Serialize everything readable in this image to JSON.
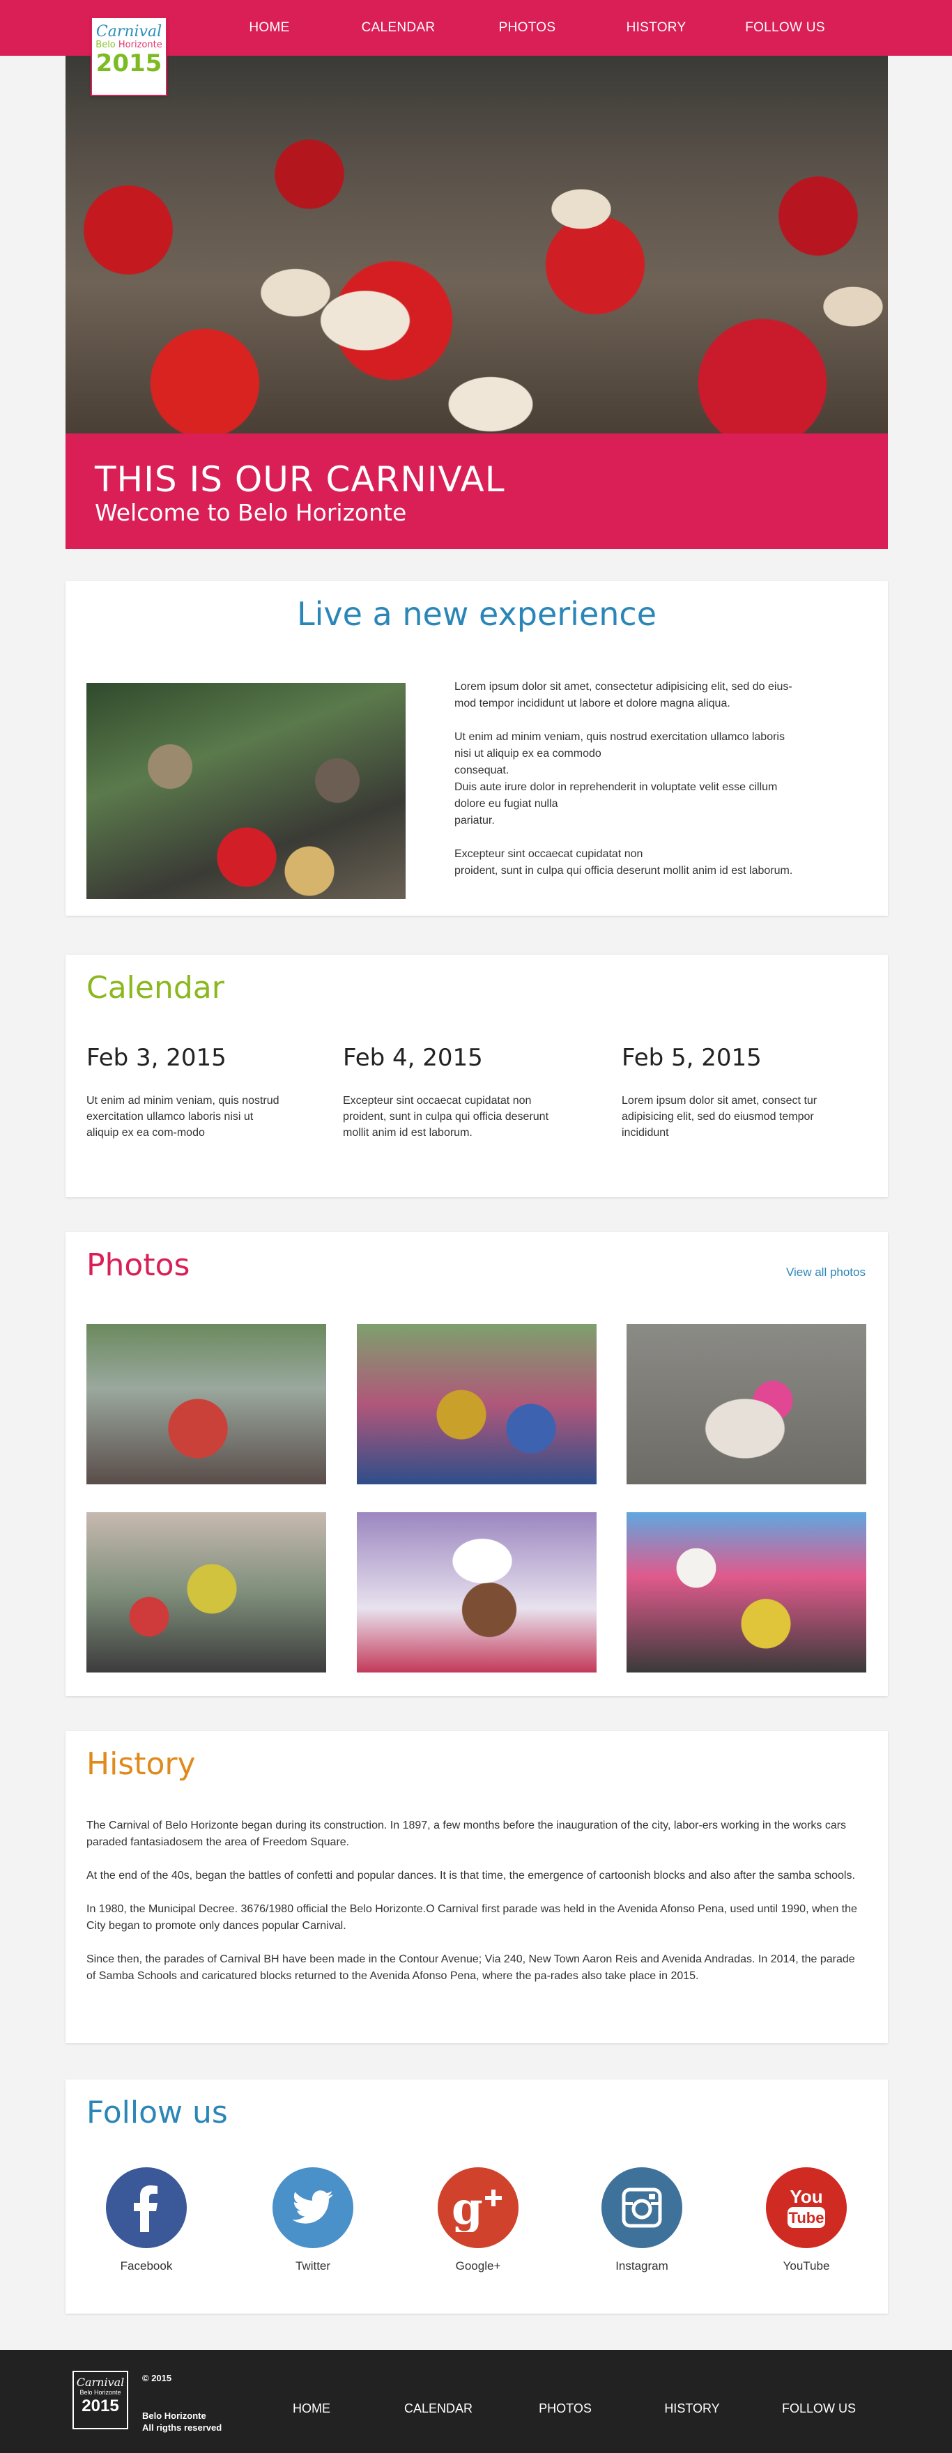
{
  "logo": {
    "line1": "Carnival",
    "line2a": "Belo",
    "line2b": "Horizonte",
    "line3": "2015"
  },
  "nav": {
    "items": [
      {
        "label": "HOME"
      },
      {
        "label": "CALENDAR"
      },
      {
        "label": "PHOTOS"
      },
      {
        "label": "HISTORY"
      },
      {
        "label": "FOLLOW US"
      }
    ]
  },
  "hero": {
    "title": "THIS IS OUR CARNIVAL",
    "subtitle": "Welcome to Belo Horizonte"
  },
  "experience": {
    "title": "Live a new experience",
    "paragraphs": [
      "Lorem ipsum dolor sit amet, consectetur adipisicing elit, sed do eius-\nmod tempor incididunt ut labore et dolore magna aliqua.",
      "Ut enim ad minim veniam, quis nostrud exercitation ullamco laboris\nnisi ut aliquip ex ea commodo\nconsequat.\nDuis aute irure dolor in reprehenderit in voluptate velit esse cillum\ndolore eu fugiat nulla\npariatur.",
      "Excepteur sint occaecat cupidatat non\nproident, sunt in culpa qui officia deserunt mollit anim id est laborum."
    ]
  },
  "calendar": {
    "title": "Calendar",
    "days": [
      {
        "date": "Feb 3, 2015",
        "desc": "Ut enim ad minim veniam, quis nostrud exercitation ullamco laboris nisi ut aliquip ex ea com-modo"
      },
      {
        "date": "Feb 4, 2015",
        "desc": "Excepteur sint occaecat cupidatat non proident, sunt in culpa qui officia deserunt mollit anim id est laborum."
      },
      {
        "date": "Feb 5, 2015",
        "desc": "Lorem ipsum dolor sit amet, consect tur adipisicing elit, sed do eiusmod tempor incididunt"
      }
    ]
  },
  "photos": {
    "title": "Photos",
    "view_all": "View all photos"
  },
  "history": {
    "title": "History",
    "paragraphs": [
      "The Carnival of Belo Horizonte began during its construction. In 1897, a few months before the inauguration of the city, labor-ers working in the works cars paraded fantasiadosem the area of Freedom Square.",
      "At the end of the 40s, began the battles of confetti and popular dances. It is that time, the emergence of cartoonish blocks and also after the samba schools.",
      "In 1980, the Municipal Decree. 3676/1980 official the Belo Horizonte.O Carnival first parade was held in the Avenida Afonso Pena, used until 1990, when the City began to promote only dances popular Carnival.",
      "Since then, the parades of Carnival BH have been made in the Contour Avenue; Via 240, New Town Aaron Reis and Avenida Andradas. In 2014, the parade of Samba Schools and caricatured blocks returned to the Avenida Afonso Pena, where the pa-rades also take place in 2015."
    ]
  },
  "follow": {
    "title": "Follow us",
    "networks": [
      {
        "label": "Facebook",
        "icon": "facebook-icon",
        "color": "#3b5998"
      },
      {
        "label": "Twitter",
        "icon": "twitter-icon",
        "color": "#4a90c9"
      },
      {
        "label": "Google+",
        "icon": "google-plus-icon",
        "color": "#d0422c"
      },
      {
        "label": "Instagram",
        "icon": "instagram-icon",
        "color": "#3f729b"
      },
      {
        "label": "YouTube",
        "icon": "youtube-icon",
        "color": "#d02b23"
      }
    ]
  },
  "footer": {
    "copyright": "© 2015",
    "address_line1": "Belo Horizonte",
    "address_line2": "All rigths reserved",
    "items": [
      {
        "label": "HOME"
      },
      {
        "label": "CALENDAR"
      },
      {
        "label": "PHOTOS"
      },
      {
        "label": "HISTORY"
      },
      {
        "label": "FOLLOW US"
      }
    ]
  },
  "colors": {
    "brand_pink": "#d91f56",
    "blue": "#2b86b8",
    "green": "#8ab81e",
    "orange": "#e08a1c",
    "footer_bg": "#222222"
  }
}
